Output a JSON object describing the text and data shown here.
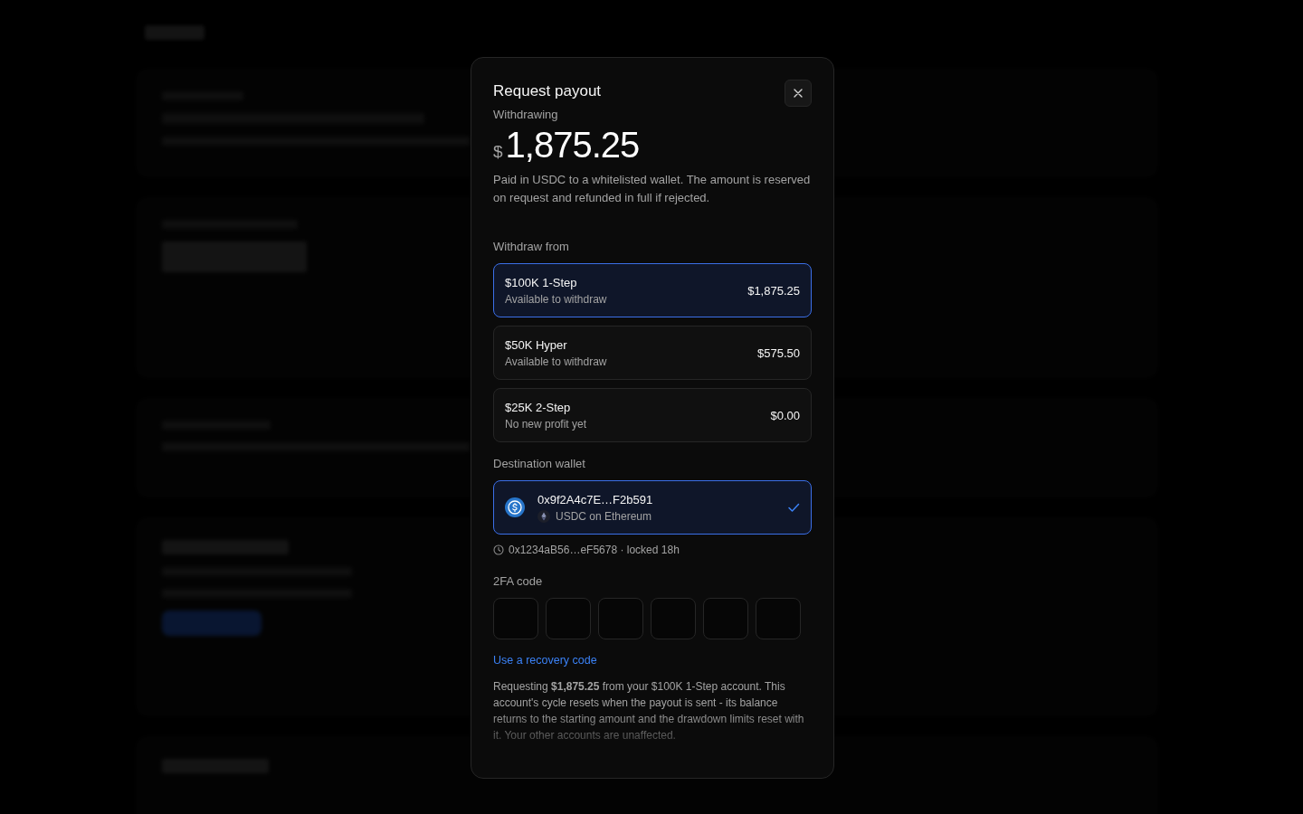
{
  "dialog": {
    "title": "Request payout",
    "withdrawing_label": "Withdrawing",
    "currency": "$",
    "amount": "1,875.25",
    "description": "Paid in USDC to a whitelisted wallet. The amount is reserved on request and refunded in full if rejected.",
    "withdraw_from_label": "Withdraw from",
    "accounts": [
      {
        "name": "$100K 1-Step",
        "subtitle": "Available to withdraw",
        "amount": "$1,875.25",
        "selected": true
      },
      {
        "name": "$50K Hyper",
        "subtitle": "Available to withdraw",
        "amount": "$575.50",
        "selected": false
      },
      {
        "name": "$25K 2-Step",
        "subtitle": "No new profit yet",
        "amount": "$0.00",
        "selected": false
      }
    ],
    "destination_label": "Destination wallet",
    "wallets": [
      {
        "address": "0x9f2A4c7E…F2b591",
        "network": "USDC on Ethereum",
        "selected": true
      }
    ],
    "locked_wallet": "0x1234aB56…eF5678 · locked 18h",
    "twofa_label": "2FA code",
    "code_fields": [
      {
        "focused": false
      },
      {
        "focused": false
      },
      {
        "focused": false
      },
      {
        "focused": false
      },
      {
        "focused": false
      },
      {
        "focused": false
      }
    ],
    "recovery_link": "Use a recovery code",
    "summary": "Requesting **$1,875.25** from your $100K 1-Step account. This account's cycle resets when the payout is sent - its balance returns to the starting amount and the drawdown limits reset with it. Your other accounts are unaffected."
  }
}
